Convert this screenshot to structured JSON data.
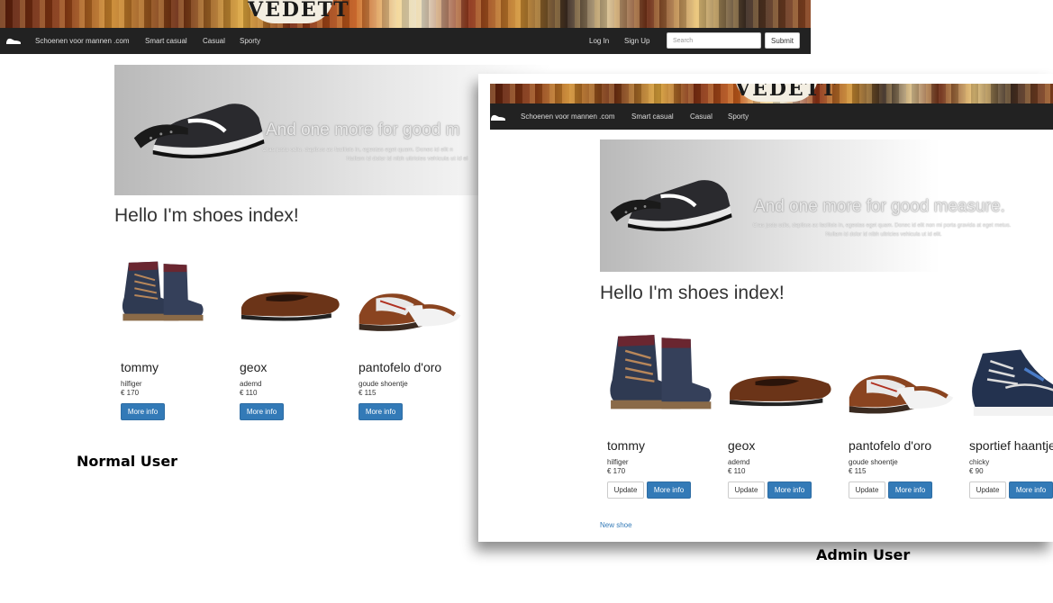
{
  "normal": {
    "caption": "Normal User",
    "banner_brand": "VEDETT",
    "nav": {
      "brand": "Schoenen voor mannen .com",
      "links": [
        "Smart casual",
        "Casual",
        "Sporty"
      ],
      "login": "Log In",
      "signup": "Sign Up",
      "search_placeholder": "Search",
      "submit": "Submit"
    },
    "hero": {
      "title": "And one more for good m",
      "text_line1": "Cras justo odio, dapibus ac facilisis in, egestas eget quam. Donec id elit n",
      "text_line2": "Nullam id dolor id nibh ultricies vehicula ut id el"
    },
    "heading": "Hello I'm shoes index!",
    "products": [
      {
        "name": "tommy",
        "desc": "hilfiger",
        "price": "€ 170",
        "more": "More info"
      },
      {
        "name": "geox",
        "desc": "ademd",
        "price": "€ 110",
        "more": "More info"
      },
      {
        "name": "pantofelo d'oro",
        "desc": "goude shoentje",
        "price": "€ 115",
        "more": "More info"
      }
    ]
  },
  "admin": {
    "caption": "Admin User",
    "banner_brand": "VEDETT",
    "nav": {
      "brand": "Schoenen voor mannen .com",
      "links": [
        "Smart casual",
        "Casual",
        "Sporty"
      ]
    },
    "hero": {
      "title": "And one more for good measure.",
      "text_line1": "Cras justo odio, dapibus ac facilisis in, egestas eget quam. Donec id elit non mi porta gravida at eget metus.",
      "text_line2": "Nullam id dolor id nibh ultricies vehicula ut id elit."
    },
    "heading": "Hello I'm shoes index!",
    "products": [
      {
        "name": "tommy",
        "desc": "hilfiger",
        "price": "€ 170",
        "update": "Update",
        "more": "More info"
      },
      {
        "name": "geox",
        "desc": "ademd",
        "price": "€ 110",
        "update": "Update",
        "more": "More info"
      },
      {
        "name": "pantofelo d'oro",
        "desc": "goude shoentje",
        "price": "€ 115",
        "update": "Update",
        "more": "More info"
      },
      {
        "name": "sportief haantje",
        "desc": "chicky",
        "price": "€ 90",
        "update": "Update",
        "more": "More info"
      }
    ],
    "new_shoe": "New shoe"
  },
  "icons": {
    "brand": "shoe-icon",
    "products": [
      "boot-image",
      "dress-shoe-image",
      "loafer-image",
      "hightop-sneaker-image"
    ]
  }
}
